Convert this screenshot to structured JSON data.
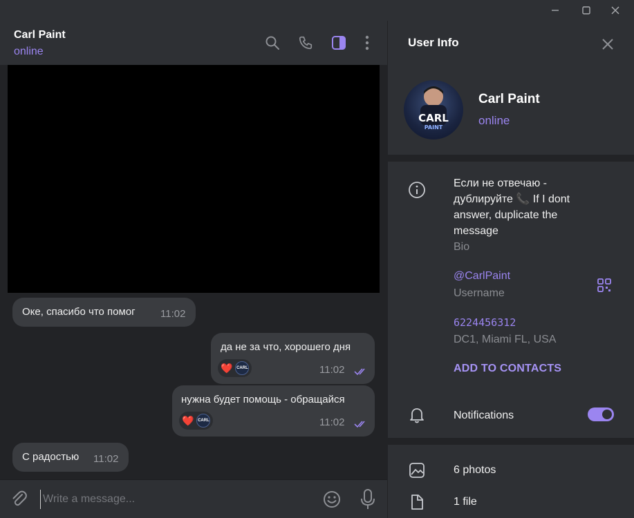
{
  "chat": {
    "name": "Carl Paint",
    "status": "online"
  },
  "messages": [
    {
      "dir": "in",
      "text": "Оке, спасибо что помог",
      "time": "11:02"
    },
    {
      "dir": "out",
      "text": "да не за что, хорошего дня",
      "time": "11:02",
      "reaction": "❤️"
    },
    {
      "dir": "out",
      "text": "нужна будет помощь - обращайся",
      "time": "11:02",
      "reaction": "❤️"
    },
    {
      "dir": "in",
      "text": "С радостью",
      "time": "11:02"
    }
  ],
  "reaction_avatar_text": "CARL",
  "composer": {
    "placeholder": "Write a message..."
  },
  "info": {
    "title": "User Info",
    "name": "Carl Paint",
    "status": "online",
    "bio": "Если не отвечаю - дублируйте 📞 If I dont answer, duplicate the message",
    "bio_label": "Bio",
    "username": "@CarlPaint",
    "username_label": "Username",
    "phone": "6224456312",
    "phone_label": "DC1, Miami FL, USA",
    "add_contacts": "ADD TO CONTACTS",
    "notifications": "Notifications",
    "notifications_on": true,
    "photos": "6 photos",
    "files": "1 file"
  },
  "avatar_text": "CARL PAINT",
  "colors": {
    "accent": "#9b85f0",
    "panel": "#2e3034",
    "background": "#222326",
    "bubble": "#3a3c40"
  }
}
